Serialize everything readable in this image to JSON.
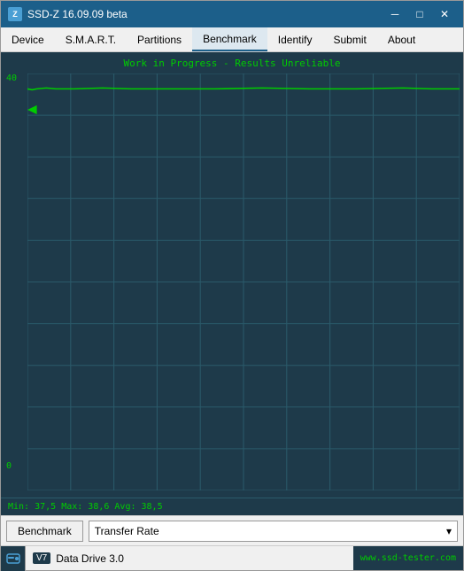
{
  "titleBar": {
    "icon": "Z",
    "title": "SSD-Z 16.09.09 beta",
    "minimize": "─",
    "maximize": "□",
    "close": "✕"
  },
  "menuBar": {
    "items": [
      {
        "label": "Device",
        "active": false
      },
      {
        "label": "S.M.A.R.T.",
        "active": false
      },
      {
        "label": "Partitions",
        "active": false
      },
      {
        "label": "Benchmark",
        "active": true
      },
      {
        "label": "Identify",
        "active": false
      },
      {
        "label": "Submit",
        "active": false
      },
      {
        "label": "About",
        "active": false
      }
    ]
  },
  "chart": {
    "title": "Work in Progress - Results Unreliable",
    "yLabelTop": "40",
    "yLabelBottom": "0",
    "statusText": "Min: 37,5  Max: 38,6  Avg: 38,5"
  },
  "toolbar": {
    "benchmarkButton": "Benchmark",
    "dropdownValue": "Transfer Rate",
    "dropdownIcon": "▾"
  },
  "statusBar": {
    "badge": "V7",
    "driveLabel": "Data Drive 3.0",
    "website": "www.ssd-tester.com"
  }
}
